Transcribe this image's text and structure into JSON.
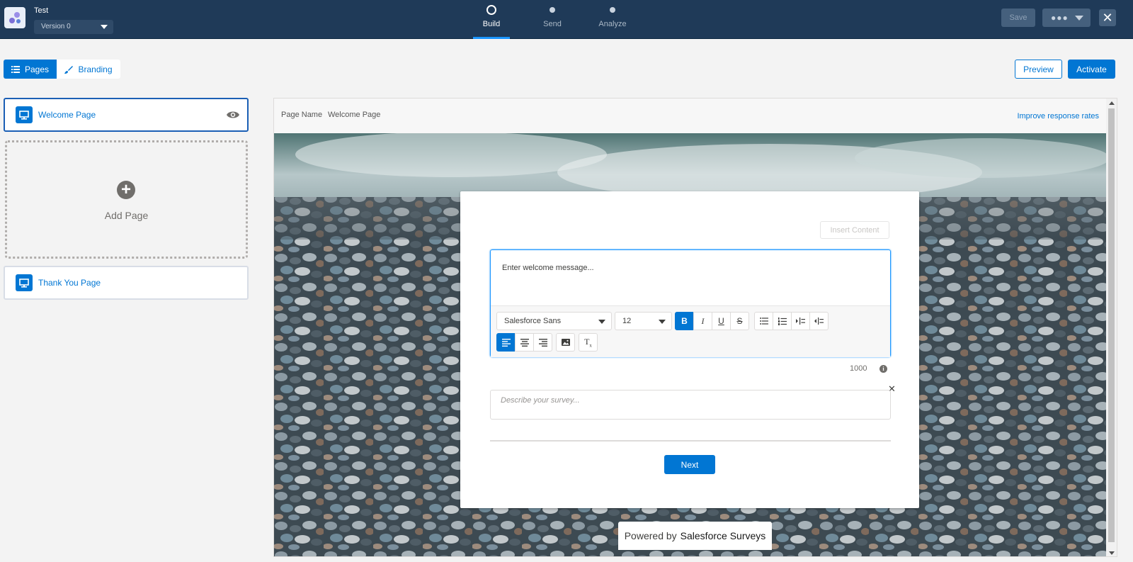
{
  "header": {
    "app_title": "Test",
    "version": "Version 0",
    "steps": [
      {
        "label": "Build",
        "active": true
      },
      {
        "label": "Send",
        "active": false
      },
      {
        "label": "Analyze",
        "active": false
      }
    ],
    "save_label": "Save",
    "close_glyph": "✕"
  },
  "view_tabs": {
    "pages": "Pages",
    "branding": "Branding"
  },
  "actions": {
    "preview": "Preview",
    "activate": "Activate"
  },
  "pages_panel": {
    "pages": [
      {
        "label": "Welcome Page",
        "selected": true
      },
      {
        "label": "Thank You Page",
        "selected": false
      }
    ],
    "add_page": "Add Page"
  },
  "canvas": {
    "page_name_label": "Page Name",
    "page_name_value": "Welcome Page",
    "improve_link": "Improve response rates",
    "insert_content": "Insert Content",
    "editor": {
      "placeholder": "Enter welcome message...",
      "font": "Salesforce Sans",
      "size": "12",
      "bold_active": true,
      "align_left_active": true
    },
    "char_counter": "1000",
    "description_placeholder": "Describe your survey...",
    "next_button": "Next",
    "powered_by_prefix": "Powered by",
    "powered_by_brand": "Salesforce Surveys"
  },
  "colors": {
    "header_bg": "#1f3a58",
    "brand_blue": "#0176d3",
    "accent_blue": "#1b96ff"
  }
}
